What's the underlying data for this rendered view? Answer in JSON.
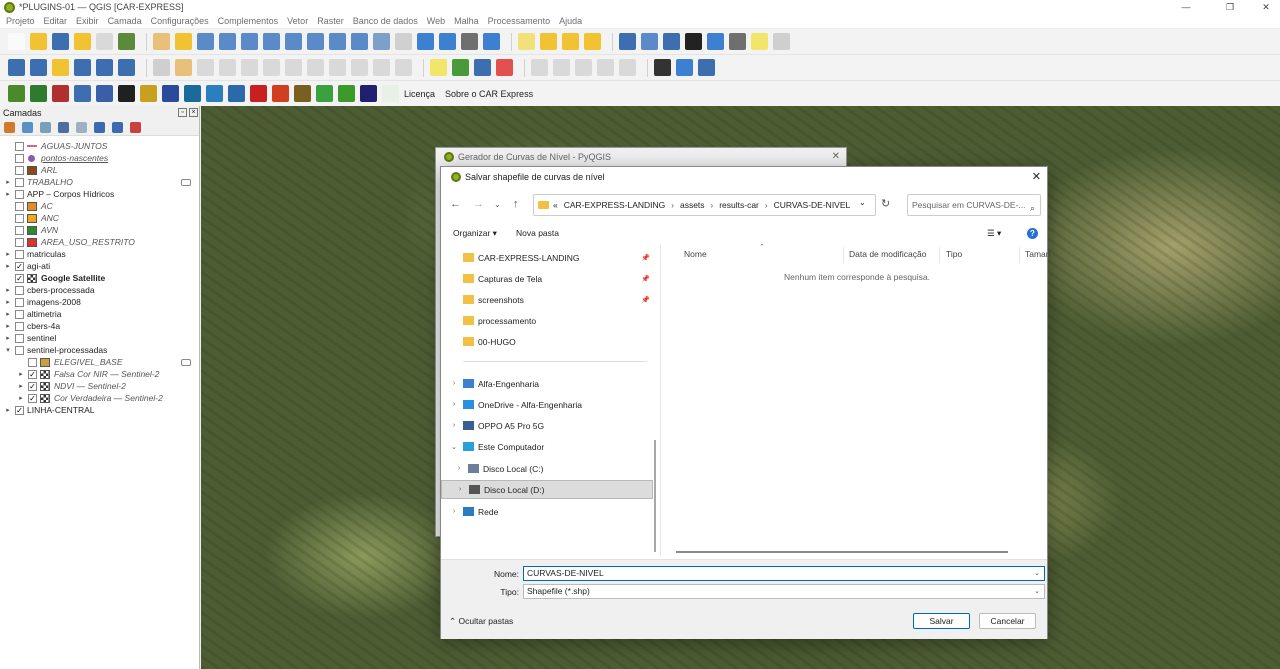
{
  "window": {
    "title": "*PLUGINS-01 — QGIS [CAR-EXPRESS]",
    "minimize": "—",
    "maximize": "❐",
    "close": "✕"
  },
  "menu": [
    "Projeto",
    "Editar",
    "Exibir",
    "Camada",
    "Configurações",
    "Complementos",
    "Vetor",
    "Raster",
    "Banco de dados",
    "Web",
    "Malha",
    "Processamento",
    "Ajuda"
  ],
  "plugin_toolbar": {
    "licenca": "Licença",
    "sobre": "Sobre o CAR Express"
  },
  "layers_panel": {
    "title": "Camadas",
    "layers": [
      {
        "name": "AGUAS-JUNTOS",
        "style": "italic",
        "checked": false,
        "arrow": "",
        "indent": 0,
        "sym": "line",
        "color": "#e0607e"
      },
      {
        "name": "pontos-nascentes",
        "style": "italic-underline",
        "checked": false,
        "arrow": "",
        "indent": 0,
        "sym": "dot",
        "color": "#8a5bb0"
      },
      {
        "name": "ARL",
        "style": "italic",
        "checked": false,
        "arrow": "",
        "indent": 0,
        "sym": "fill",
        "color": "#8a4a1c"
      },
      {
        "name": "TRABALHO",
        "style": "italic",
        "checked": false,
        "arrow": "▸",
        "indent": 0,
        "sym": "none",
        "color": "",
        "extra": true
      },
      {
        "name": "APP – Corpos Hídricos",
        "style": "normal",
        "checked": false,
        "arrow": "▸",
        "indent": 0,
        "sym": "none",
        "color": ""
      },
      {
        "name": "AC",
        "style": "italic",
        "checked": false,
        "arrow": "",
        "indent": 0,
        "sym": "fill",
        "color": "#e88a2a"
      },
      {
        "name": "ANC",
        "style": "italic",
        "checked": false,
        "arrow": "",
        "indent": 0,
        "sym": "fill",
        "color": "#f0a81a"
      },
      {
        "name": "AVN",
        "style": "italic",
        "checked": false,
        "arrow": "",
        "indent": 0,
        "sym": "fill",
        "color": "#2e8a2e"
      },
      {
        "name": "AREA_USO_RESTRITO",
        "style": "italic",
        "checked": false,
        "arrow": "",
        "indent": 0,
        "sym": "fill",
        "color": "#d8342c"
      },
      {
        "name": "matriculas",
        "style": "normal",
        "checked": false,
        "arrow": "▸",
        "indent": 0,
        "sym": "none",
        "color": ""
      },
      {
        "name": "agi-ati",
        "style": "normal",
        "checked": true,
        "arrow": "▸",
        "indent": 0,
        "sym": "none",
        "color": ""
      },
      {
        "name": "Google Satellite",
        "style": "bold",
        "checked": true,
        "arrow": "",
        "indent": 0,
        "sym": "raster",
        "color": ""
      },
      {
        "name": "cbers-processada",
        "style": "normal",
        "checked": false,
        "arrow": "▸",
        "indent": 0,
        "sym": "none",
        "color": ""
      },
      {
        "name": "imagens-2008",
        "style": "normal",
        "checked": false,
        "arrow": "▸",
        "indent": 0,
        "sym": "none",
        "color": ""
      },
      {
        "name": "altimetria",
        "style": "normal",
        "checked": false,
        "arrow": "▸",
        "indent": 0,
        "sym": "none",
        "color": ""
      },
      {
        "name": "cbers-4a",
        "style": "normal",
        "checked": false,
        "arrow": "▸",
        "indent": 0,
        "sym": "none",
        "color": ""
      },
      {
        "name": "sentinel",
        "style": "normal",
        "checked": false,
        "arrow": "▸",
        "indent": 0,
        "sym": "none",
        "color": ""
      },
      {
        "name": "sentinel-processadas",
        "style": "normal",
        "checked": false,
        "arrow": "▾",
        "indent": 0,
        "sym": "none",
        "color": ""
      },
      {
        "name": "ELEGIVEL_BASE",
        "style": "italic",
        "checked": false,
        "arrow": "",
        "indent": 1,
        "sym": "fill",
        "color": "#c8a040",
        "extra": true
      },
      {
        "name": "Falsa Cor NIR — Sentinel-2",
        "style": "italic",
        "checked": true,
        "arrow": "▸",
        "indent": 1,
        "sym": "raster",
        "color": ""
      },
      {
        "name": "NDVI — Sentinel-2",
        "style": "italic",
        "checked": true,
        "arrow": "▸",
        "indent": 1,
        "sym": "raster",
        "color": ""
      },
      {
        "name": "Cor Verdadeira — Sentinel-2",
        "style": "italic",
        "checked": true,
        "arrow": "▸",
        "indent": 1,
        "sym": "raster",
        "color": ""
      },
      {
        "name": "LINHA-CENTRAL",
        "style": "normal",
        "checked": true,
        "arrow": "▸",
        "indent": 0,
        "sym": "none",
        "color": ""
      }
    ]
  },
  "generator_dialog": {
    "title": "Gerador de Curvas de Nível - PyQGIS",
    "close": "✕"
  },
  "save_dialog": {
    "title": "Salvar shapefile de curvas de nível",
    "close": "✕",
    "breadcrumb": [
      "«",
      "CAR-EXPRESS-LANDING",
      "assets",
      "results-car",
      "CURVAS-DE-NIVEL"
    ],
    "search_placeholder": "Pesquisar em CURVAS-DE-...",
    "organize": "Organizar ▾",
    "new_folder": "Nova pasta",
    "view": "☰ ▾",
    "quick_access": [
      {
        "label": "CAR-EXPRESS-LANDING",
        "pinned": true
      },
      {
        "label": "Capturas de Tela",
        "pinned": true
      },
      {
        "label": "screenshots",
        "pinned": true
      },
      {
        "label": "processamento",
        "pinned": false
      },
      {
        "label": "00-HUGO",
        "pinned": false
      }
    ],
    "tree": [
      {
        "label": "Alfa-Engenharia",
        "exp": "›",
        "icon": "#3d7fd0",
        "indent": 0
      },
      {
        "label": "OneDrive - Alfa-Engenharia",
        "exp": "›",
        "icon": "#2b8fe0",
        "indent": 0
      },
      {
        "label": "OPPO A5 Pro 5G",
        "exp": "›",
        "icon": "#375f8f",
        "indent": 0
      },
      {
        "label": "Este Computador",
        "exp": "⌄",
        "icon": "#2aa0d8",
        "indent": 0
      },
      {
        "label": "Disco Local (C:)",
        "exp": "›",
        "icon": "#6c7f96",
        "indent": 1
      },
      {
        "label": "Disco Local (D:)",
        "exp": "›",
        "icon": "#555555",
        "indent": 1,
        "selected": true
      },
      {
        "label": "Rede",
        "exp": "›",
        "icon": "#2a7bc0",
        "indent": 0
      }
    ],
    "columns": [
      "Nome",
      "Data de modificação",
      "Tipo",
      "Taman"
    ],
    "empty_message": "Nenhum item corresponde à pesquisa.",
    "name_label": "Nome:",
    "name_value": "CURVAS-DE-NIVEL",
    "type_label": "Tipo:",
    "type_value": "Shapefile (*.shp)",
    "hide_folders": "Ocultar pastas",
    "save": "Salvar",
    "cancel": "Cancelar"
  }
}
